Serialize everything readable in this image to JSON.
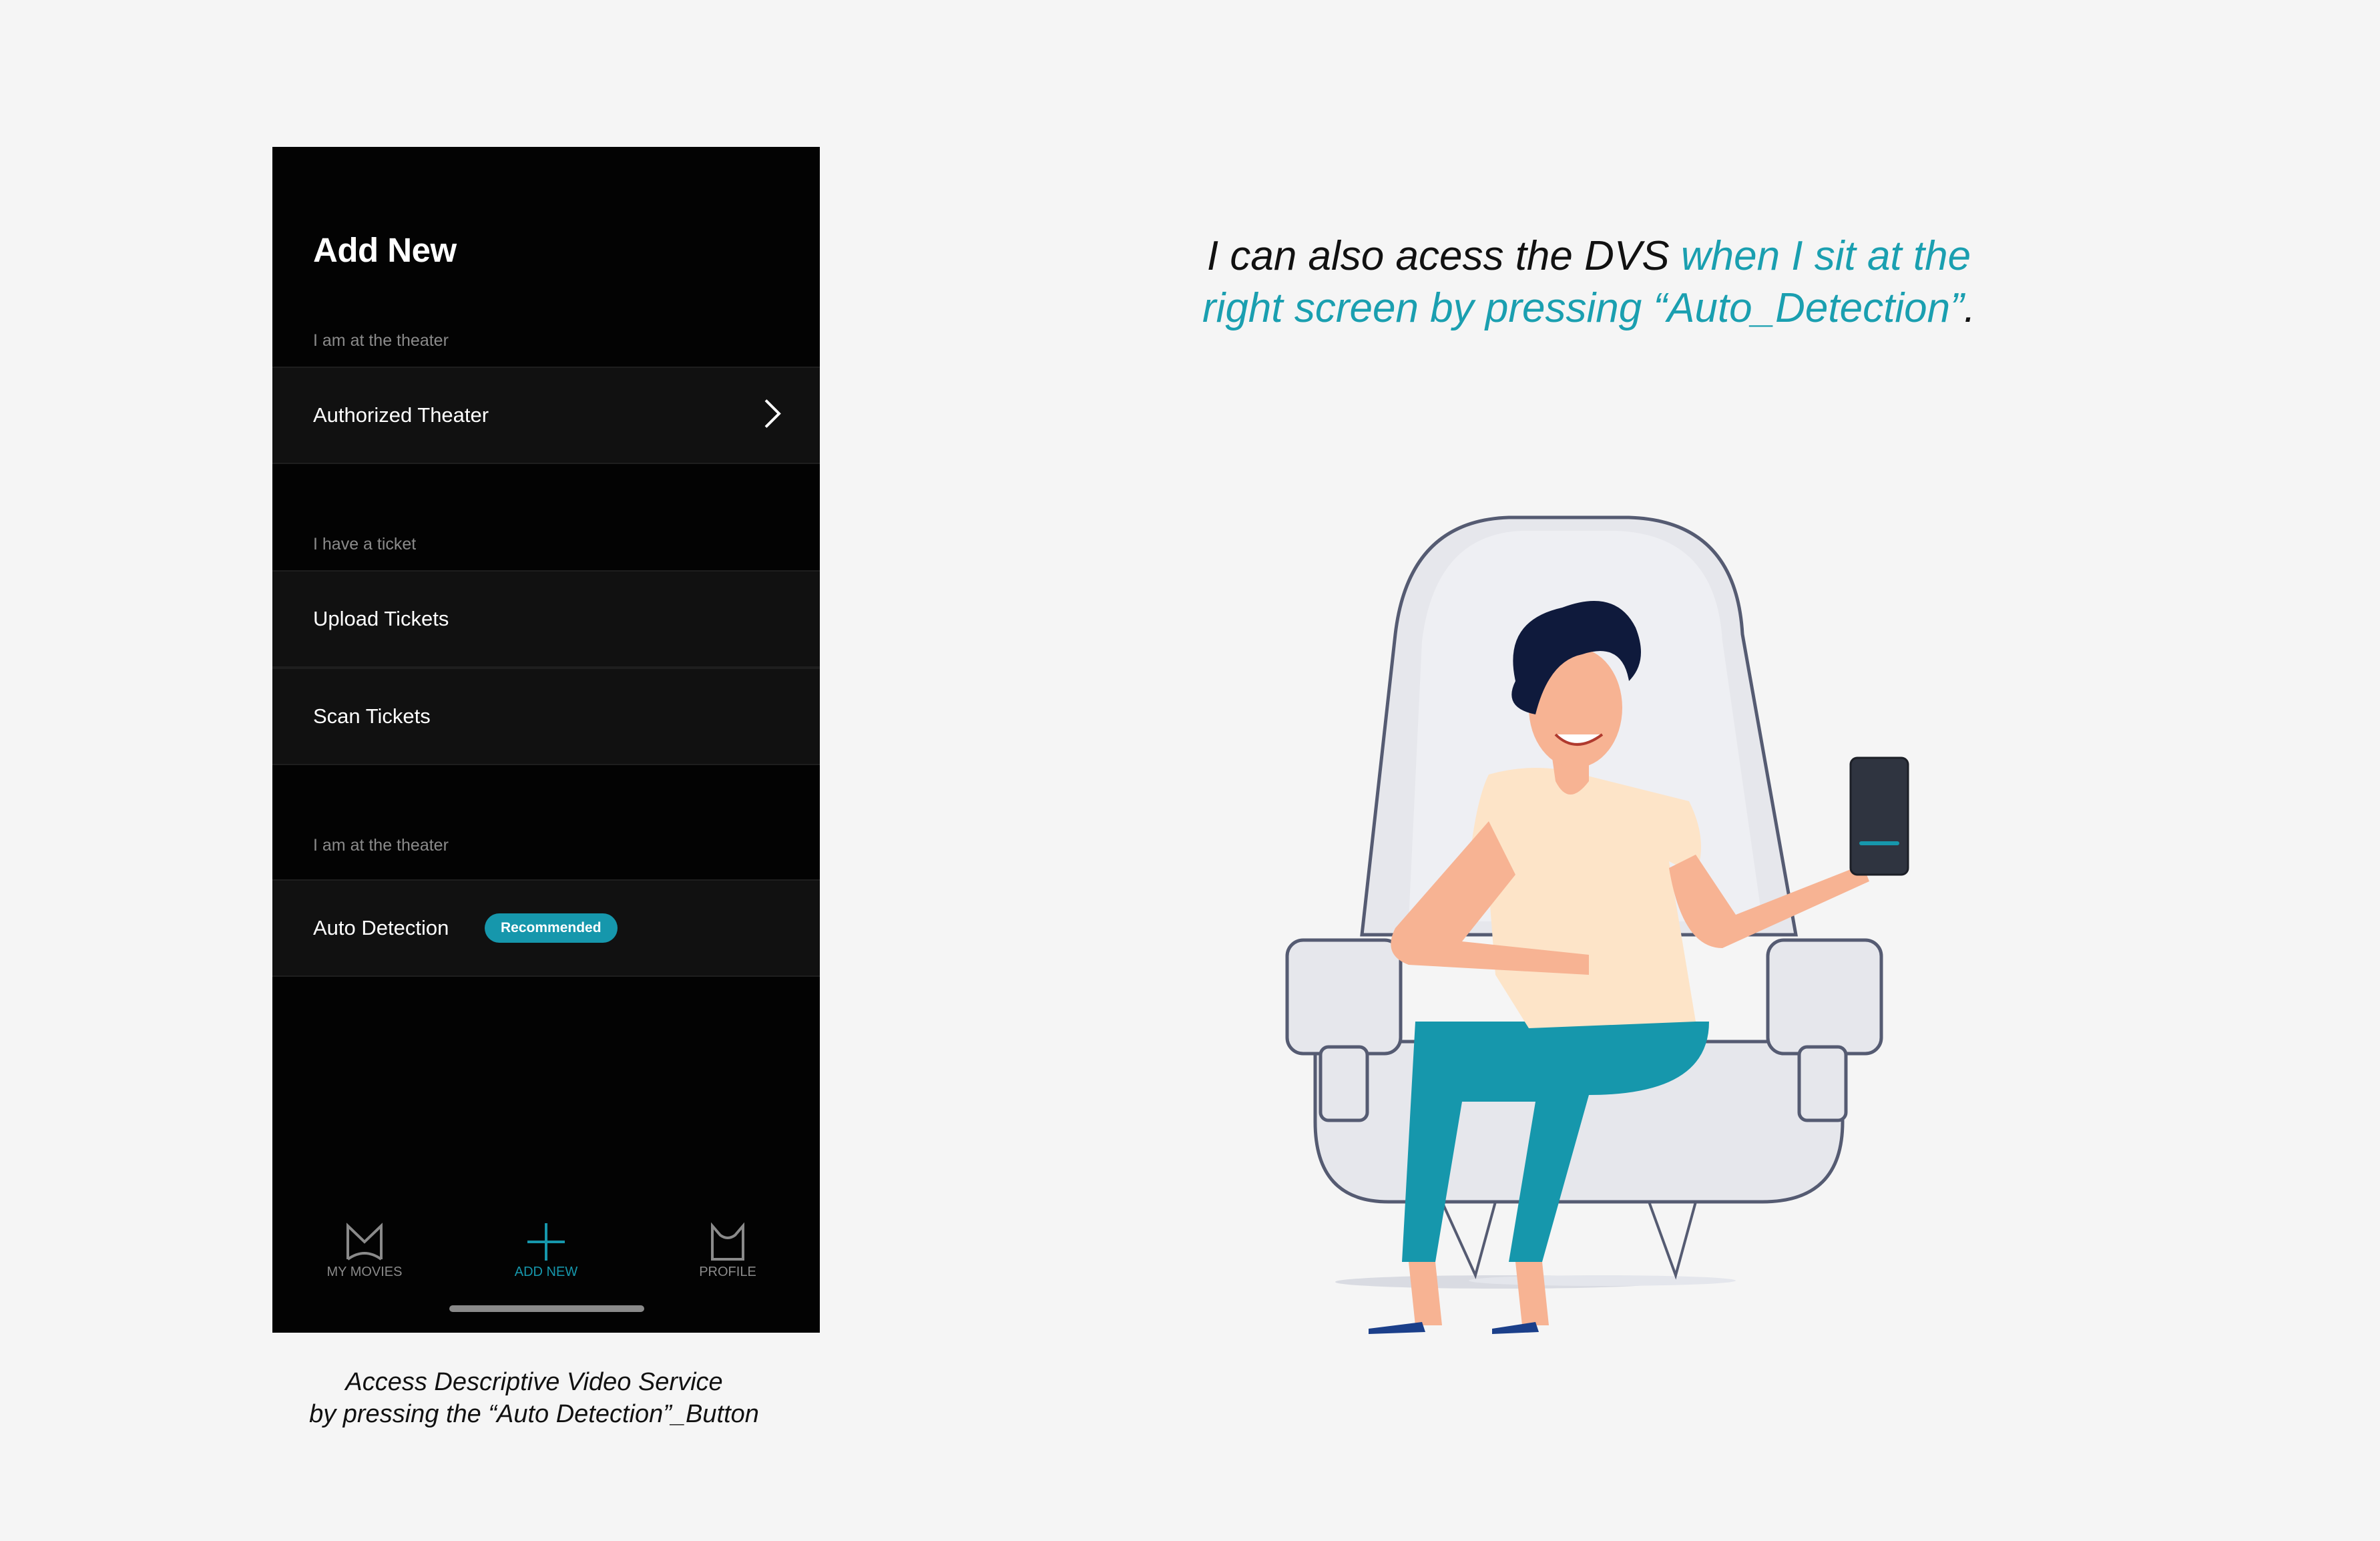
{
  "app": {
    "title": "Add New",
    "sections": [
      {
        "label": "I am at the theater",
        "items": [
          {
            "label": "Authorized Theater"
          }
        ]
      },
      {
        "label": "I have a ticket",
        "items": [
          {
            "label": "Upload Tickets"
          },
          {
            "label": "Scan Tickets"
          }
        ]
      },
      {
        "label": "I am at the theater",
        "items": [
          {
            "label": "Auto Detection",
            "badge": "Recommended"
          }
        ]
      }
    ],
    "nav": [
      {
        "label": "MY MOVIES",
        "icon": "movies-icon"
      },
      {
        "label": "ADD NEW",
        "icon": "plus-icon",
        "active": true
      },
      {
        "label": "PROFILE",
        "icon": "profile-icon"
      }
    ]
  },
  "caption": {
    "line1": "Access Descriptive Video Service",
    "line2": "by pressing the “Auto Detection”_Button"
  },
  "headline": {
    "part1": "I can also acess the DVS ",
    "part2": "when I sit at the",
    "part3": "right screen by pressing “Auto_Detection”",
    "part4": "."
  },
  "colors": {
    "accent": "#1697ac",
    "phone_bg": "#030303",
    "row_bg": "#111111",
    "page_bg": "#f5f5f5"
  }
}
